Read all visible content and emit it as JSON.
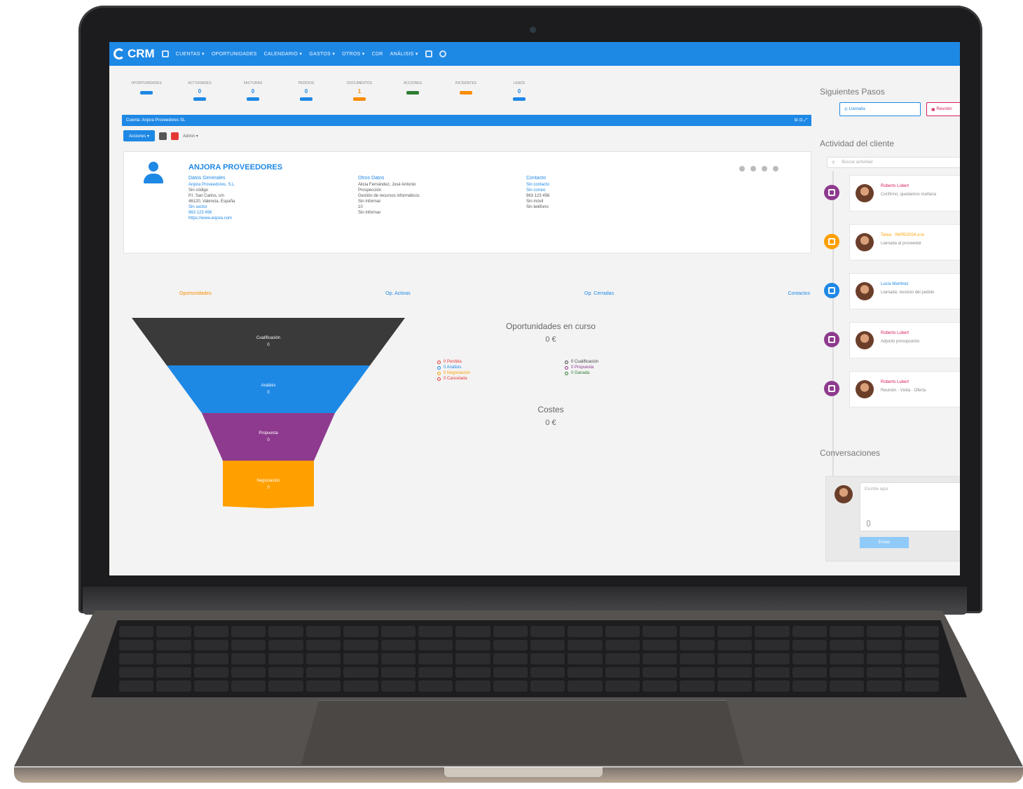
{
  "nav": {
    "logo": "CRM",
    "items": [
      "CUENTAS ▾",
      "OPORTUNIDADES",
      "CALENDARIO ▾",
      "GASTOS ▾",
      "OTROS ▾",
      "CDR",
      "ANÁLISIS ▾"
    ]
  },
  "stats": [
    {
      "label": "OPORTUNIDADES",
      "value": "",
      "color": "#1e88e5"
    },
    {
      "label": "ACTIVIDADES",
      "value": "0",
      "color": "#1e88e5"
    },
    {
      "label": "FACTURAS",
      "value": "0",
      "color": "#1e88e5"
    },
    {
      "label": "PEDIDOS",
      "value": "0",
      "color": "#1e88e5"
    },
    {
      "label": "DOCUMENTOS",
      "value": "1",
      "color": "#fb8c00"
    },
    {
      "label": "ACCIONES",
      "value": "",
      "color": "#2e7d32"
    },
    {
      "label": "INCIDENTES",
      "value": "",
      "color": "#fb8c00"
    },
    {
      "label": "LEADS",
      "value": "0",
      "color": "#1e88e5"
    }
  ],
  "record_bar": {
    "title": "Cuenta: Anjora Proveedores SL"
  },
  "toolbar": {
    "primary": "Acciones ▾",
    "user": "Admin ▾"
  },
  "account": {
    "company": "ANJORA PROVEEDORES",
    "col1_header": "Datos Generales",
    "col1": [
      "Anjora Proveedores, S.L.",
      "Sin código",
      "P.I. San Carlos, s/n",
      "46120, Valencia, España",
      "Sin sector",
      "963 123 456",
      "https://www.anjora.com"
    ],
    "col2_header": "Otros Datos",
    "col2": [
      "Alicia Fernández, José Antonio",
      "Prospección",
      "Gestión de recursos informáticos",
      "Sin informar",
      "10",
      "Sin informar"
    ],
    "col3_header": "Contacto",
    "col3": [
      "Sin contacto",
      "Sin correo",
      "963 123 456",
      "Sin móvil",
      "Sin teléfono"
    ]
  },
  "tabs": {
    "t1": "Oportunidades",
    "t2": "Op. Activas",
    "t3": "Op. Cerradas",
    "t4": "Contactos"
  },
  "funnel": [
    {
      "label": "Cualificación",
      "value": "0",
      "color": "#3a3a3a"
    },
    {
      "label": "Análisis",
      "value": "0",
      "color": "#1e88e5"
    },
    {
      "label": "Propuesta",
      "value": "0",
      "color": "#8e3a8e"
    },
    {
      "label": "Negociación",
      "value": "0",
      "color": "#ffa000"
    }
  ],
  "ops": {
    "title": "Oportunidades en curso",
    "value": "0 €",
    "legend_left": [
      {
        "text": "0 Perdida",
        "color": "#e53935"
      },
      {
        "text": "0 Análisis",
        "color": "#1e88e5"
      },
      {
        "text": "0 Negociación",
        "color": "#ffa000"
      },
      {
        "text": "0 Cancelada",
        "color": "#e53935"
      }
    ],
    "legend_right": [
      {
        "text": "0 Cualificación",
        "color": "#444444"
      },
      {
        "text": "0 Propuesta",
        "color": "#8e3a8e"
      },
      {
        "text": "0 Ganada",
        "color": "#2e7d32"
      }
    ]
  },
  "costs": {
    "title": "Costes",
    "value": "0 €"
  },
  "side": {
    "next_steps": "Siguientes Pasos",
    "btn_call": "Llamada",
    "btn_other": "Reunión",
    "activity_title": "Actividad del cliente",
    "search_placeholder": "Buscar actividad",
    "activities": [
      {
        "who": "Roberto Lubert",
        "msg": "Confirmo, quedamos mañana",
        "badge": "#8e3a8e",
        "who_color": "#d81b60"
      },
      {
        "who": "Tarea · 04/05/2024 a la",
        "msg": "Llamada al proveedor",
        "badge": "#ffa000",
        "who_color": "#ffa000"
      },
      {
        "who": "Lucía Martínez",
        "msg": "Llamada: revisión del pedido",
        "badge": "#1e88e5",
        "who_color": "#1e88e5"
      },
      {
        "who": "Roberto Lubert",
        "msg": "Adjunto presupuesto",
        "badge": "#8e3a8e",
        "who_color": "#d81b60"
      },
      {
        "who": "Roberto Lubert",
        "msg": "Reunión · Visita · Oferta",
        "badge": "#8e3a8e",
        "who_color": "#d81b60"
      }
    ],
    "conversations_title": "Conversaciones",
    "conv_placeholder": "Escribe aquí",
    "conv_send": "Enviar"
  }
}
